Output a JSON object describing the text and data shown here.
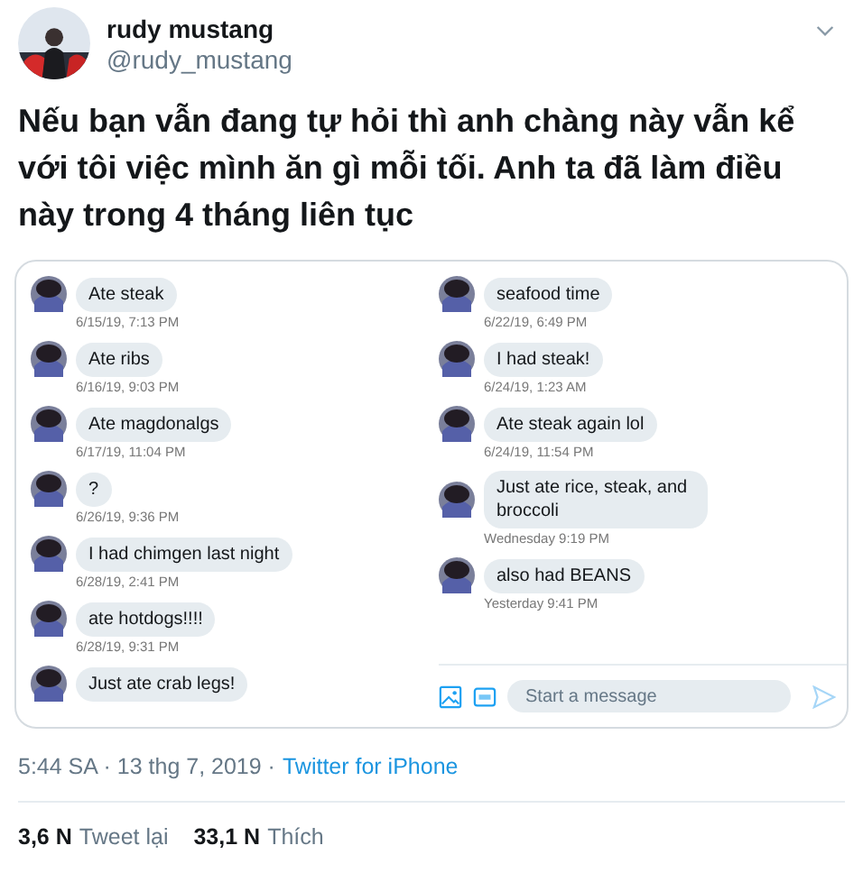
{
  "author": {
    "name": "rudy mustang",
    "handle": "@rudy_mustang"
  },
  "text": "Nếu bạn vẫn đang tự hỏi thì anh chàng này vẫn kể với tôi việc mình ăn gì mỗi tối. Anh ta đã làm điều này trong 4 tháng liên tục",
  "chat": {
    "columns": [
      {
        "messages": [
          {
            "text": "Ate steak",
            "time": "6/15/19, 7:13 PM"
          },
          {
            "text": "Ate ribs",
            "time": "6/16/19, 9:03 PM"
          },
          {
            "text": "Ate magdonalgs",
            "time": "6/17/19, 11:04 PM"
          },
          {
            "text": "?",
            "time": "6/26/19, 9:36 PM"
          },
          {
            "text": "I had chimgen last night",
            "time": "6/28/19, 2:41 PM"
          },
          {
            "text": "ate hotdogs!!!!",
            "time": "6/28/19, 9:31 PM"
          },
          {
            "text": "Just ate crab legs!"
          }
        ]
      },
      {
        "messages": [
          {
            "text": "seafood time",
            "time": "6/22/19, 6:49 PM"
          },
          {
            "text": "I had steak!",
            "time": "6/24/19, 1:23 AM"
          },
          {
            "text": "Ate steak again lol",
            "time": "6/24/19, 11:54 PM"
          },
          {
            "text": "Just ate rice, steak, and broccoli",
            "time": "Wednesday 9:19 PM"
          },
          {
            "text": "also had BEANS",
            "time": "Yesterday 9:41 PM"
          }
        ]
      }
    ],
    "composer": {
      "placeholder": "Start a message"
    }
  },
  "meta": {
    "time": "5:44 SA · 13 thg 7, 2019 ·",
    "source": "Twitter for iPhone"
  },
  "stats": [
    {
      "count": "3,6 N",
      "label": "Tweet lại"
    },
    {
      "count": "33,1 N",
      "label": "Thích"
    }
  ]
}
